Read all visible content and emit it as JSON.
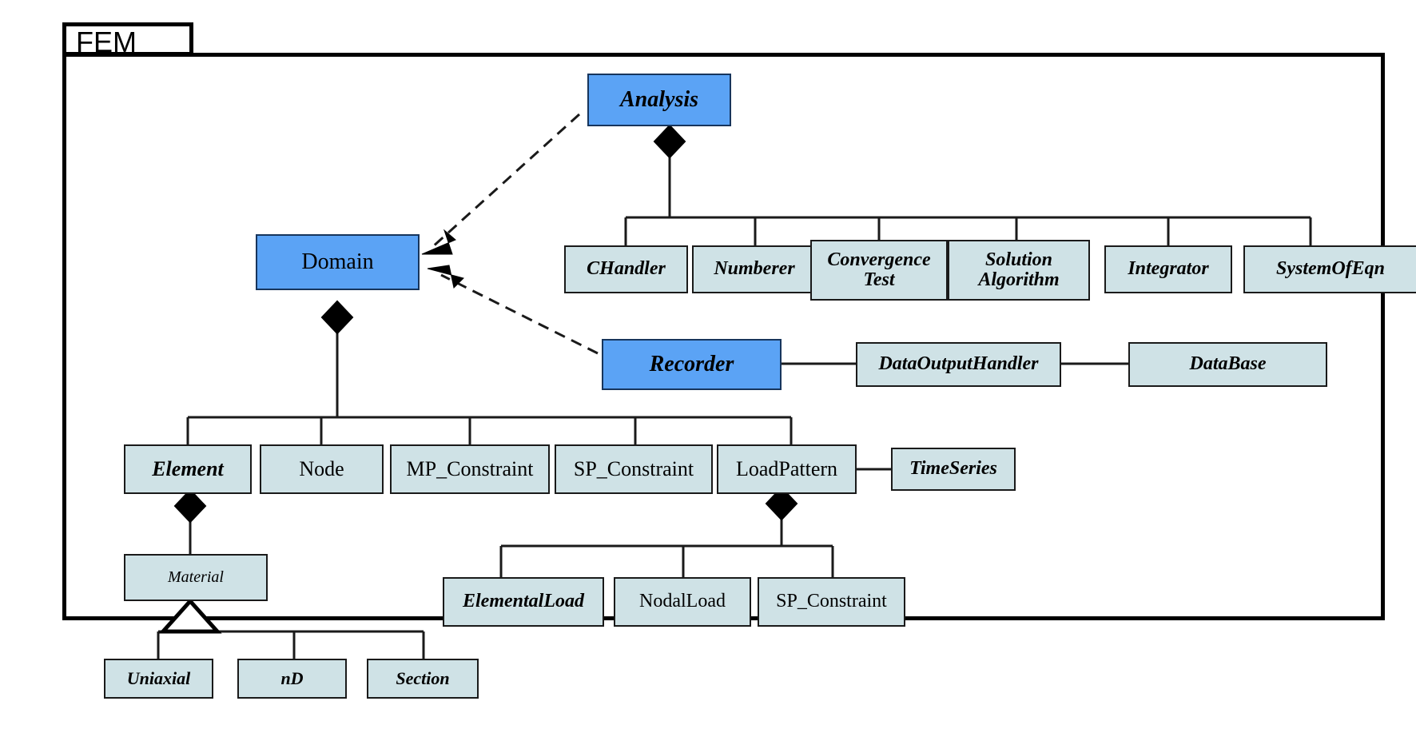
{
  "package": {
    "name": "FEM"
  },
  "diagram": {
    "type": "uml-class-diagram",
    "colors": {
      "highlight_fill": "#5ba3f5",
      "node_fill": "#cfe2e6",
      "border": "#1a1a1a",
      "background": "#ffffff"
    }
  },
  "nodes": {
    "analysis": {
      "label": "Analysis",
      "style": "abstract",
      "fill": "highlight"
    },
    "domain": {
      "label": "Domain",
      "style": "concrete",
      "fill": "highlight"
    },
    "recorder": {
      "label": "Recorder",
      "style": "abstract",
      "fill": "highlight"
    },
    "chandler": {
      "label": "CHandler",
      "style": "abstract",
      "fill": "node"
    },
    "numberer": {
      "label": "Numberer",
      "style": "abstract",
      "fill": "node"
    },
    "convergence_test": {
      "label": "Convergence\nTest",
      "style": "abstract",
      "fill": "node"
    },
    "solution_algorithm": {
      "label": "Solution\nAlgorithm",
      "style": "abstract",
      "fill": "node"
    },
    "integrator": {
      "label": "Integrator",
      "style": "abstract",
      "fill": "node"
    },
    "system_of_eqn": {
      "label": "SystemOfEqn",
      "style": "abstract",
      "fill": "node"
    },
    "data_output_handler": {
      "label": "DataOutputHandler",
      "style": "abstract",
      "fill": "node"
    },
    "database": {
      "label": "DataBase",
      "style": "abstract",
      "fill": "node"
    },
    "element": {
      "label": "Element",
      "style": "abstract",
      "fill": "node"
    },
    "node_cls": {
      "label": "Node",
      "style": "concrete",
      "fill": "node"
    },
    "mp_constraint": {
      "label": "MP_Constraint",
      "style": "concrete",
      "fill": "node"
    },
    "sp_constraint": {
      "label": "SP_Constraint",
      "style": "concrete",
      "fill": "node"
    },
    "load_pattern": {
      "label": "LoadPattern",
      "style": "concrete",
      "fill": "node"
    },
    "time_series": {
      "label": "TimeSeries",
      "style": "abstract",
      "fill": "node"
    },
    "material": {
      "label": "Material",
      "style": "plain-italic",
      "fill": "node"
    },
    "uniaxial": {
      "label": "Uniaxial",
      "style": "abstract",
      "fill": "node"
    },
    "nd": {
      "label": "nD",
      "style": "abstract",
      "fill": "node"
    },
    "section": {
      "label": "Section",
      "style": "abstract",
      "fill": "node"
    },
    "elemental_load": {
      "label": "ElementalLoad",
      "style": "abstract",
      "fill": "node"
    },
    "nodal_load": {
      "label": "NodalLoad",
      "style": "concrete",
      "fill": "node"
    },
    "sp_constraint_load": {
      "label": "SP_Constraint",
      "style": "concrete",
      "fill": "node"
    }
  },
  "relationships": [
    {
      "kind": "dependency",
      "from": "analysis",
      "to": "domain",
      "arrow": "open-filled"
    },
    {
      "kind": "dependency",
      "from": "recorder",
      "to": "domain",
      "arrow": "open-filled"
    },
    {
      "kind": "composition",
      "from": "analysis",
      "to": "chandler"
    },
    {
      "kind": "composition",
      "from": "analysis",
      "to": "numberer"
    },
    {
      "kind": "composition",
      "from": "analysis",
      "to": "convergence_test"
    },
    {
      "kind": "composition",
      "from": "analysis",
      "to": "solution_algorithm"
    },
    {
      "kind": "composition",
      "from": "analysis",
      "to": "integrator"
    },
    {
      "kind": "composition",
      "from": "analysis",
      "to": "system_of_eqn"
    },
    {
      "kind": "association",
      "from": "recorder",
      "to": "data_output_handler"
    },
    {
      "kind": "association",
      "from": "data_output_handler",
      "to": "database"
    },
    {
      "kind": "composition",
      "from": "domain",
      "to": "element"
    },
    {
      "kind": "composition",
      "from": "domain",
      "to": "node_cls"
    },
    {
      "kind": "composition",
      "from": "domain",
      "to": "mp_constraint"
    },
    {
      "kind": "composition",
      "from": "domain",
      "to": "sp_constraint"
    },
    {
      "kind": "composition",
      "from": "domain",
      "to": "load_pattern"
    },
    {
      "kind": "association",
      "from": "load_pattern",
      "to": "time_series"
    },
    {
      "kind": "composition",
      "from": "element",
      "to": "material"
    },
    {
      "kind": "generalization",
      "from": "uniaxial",
      "to": "material"
    },
    {
      "kind": "generalization",
      "from": "nd",
      "to": "material"
    },
    {
      "kind": "generalization",
      "from": "section",
      "to": "material"
    },
    {
      "kind": "composition",
      "from": "load_pattern",
      "to": "elemental_load"
    },
    {
      "kind": "composition",
      "from": "load_pattern",
      "to": "nodal_load"
    },
    {
      "kind": "composition",
      "from": "load_pattern",
      "to": "sp_constraint_load"
    }
  ]
}
